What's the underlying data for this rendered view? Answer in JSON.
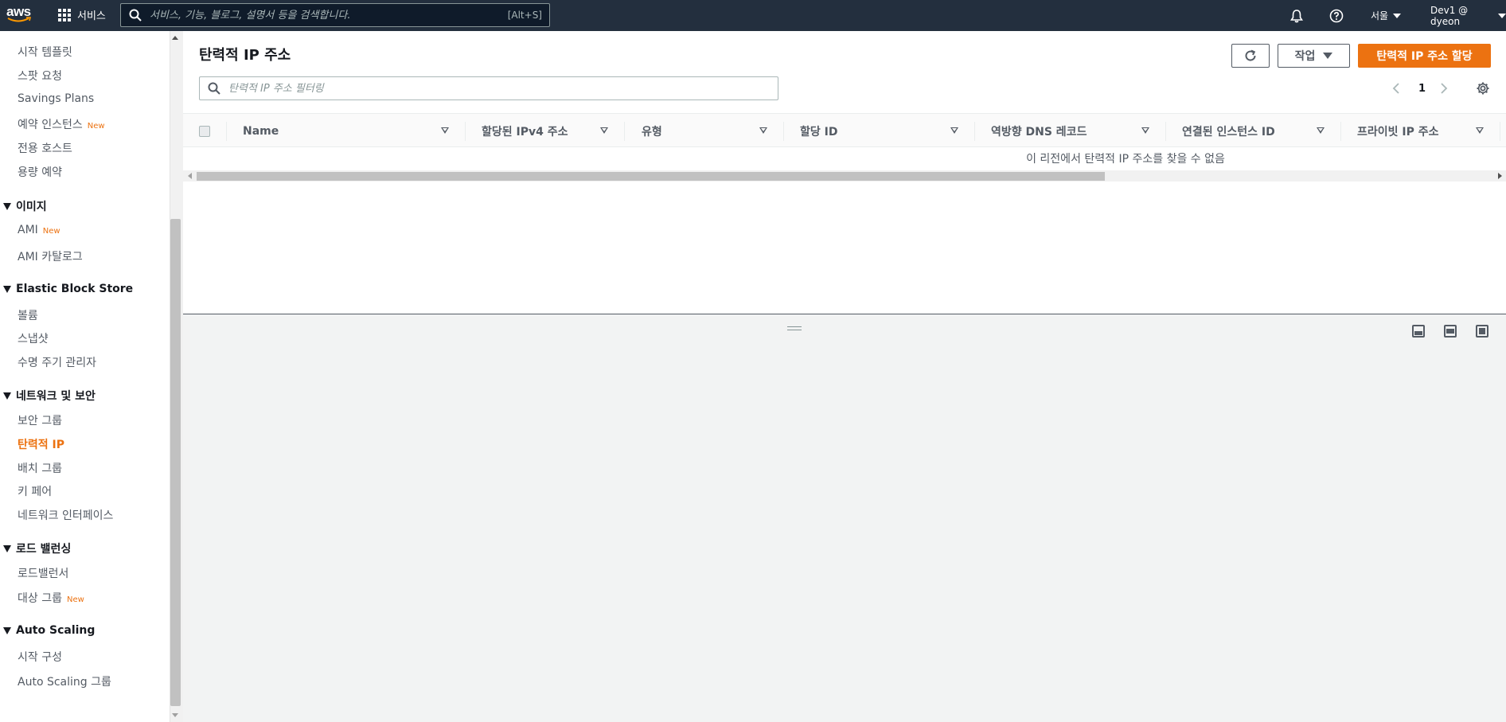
{
  "topnav": {
    "logo_text": "aws",
    "services_label": "서비스",
    "search_placeholder": "서비스, 기능, 블로그, 설명서 등을 검색합니다.",
    "search_shortcut": "[Alt+S]",
    "region_label": "서울",
    "account_label": "Dev1 @ dyeon",
    "icons": [
      "grid-icon",
      "search-icon",
      "bell-icon",
      "help-icon"
    ]
  },
  "sidebar": {
    "items": [
      {
        "label": "시작 템플릿"
      },
      {
        "label": "스팟 요청"
      },
      {
        "label": "Savings Plans"
      },
      {
        "label": "예약 인스턴스",
        "badge": "New"
      },
      {
        "label": "전용 호스트"
      },
      {
        "label": "용량 예약"
      }
    ],
    "sections": [
      {
        "title": "이미지",
        "items": [
          {
            "label": "AMI",
            "badge": "New"
          },
          {
            "label": "AMI 카탈로그"
          }
        ]
      },
      {
        "title": "Elastic Block Store",
        "items": [
          {
            "label": "볼륨"
          },
          {
            "label": "스냅샷"
          },
          {
            "label": "수명 주기 관리자"
          }
        ]
      },
      {
        "title": "네트워크 및 보안",
        "items": [
          {
            "label": "보안 그룹"
          },
          {
            "label": "탄력적 IP",
            "active": true
          },
          {
            "label": "배치 그룹"
          },
          {
            "label": "키 페어"
          },
          {
            "label": "네트워크 인터페이스"
          }
        ]
      },
      {
        "title": "로드 밸런싱",
        "items": [
          {
            "label": "로드밸런서"
          },
          {
            "label": "대상 그룹",
            "badge": "New"
          }
        ]
      },
      {
        "title": "Auto Scaling",
        "items": [
          {
            "label": "시작 구성"
          },
          {
            "label": "Auto Scaling 그룹"
          }
        ]
      }
    ]
  },
  "main": {
    "title": "탄력적 IP 주소",
    "actions_label": "작업",
    "primary_button": "탄력적 IP 주소 할당",
    "filter_placeholder": "탄력적 IP 주소 필터링",
    "page_number": "1",
    "columns": [
      "Name",
      "할당된 IPv4 주소",
      "유형",
      "할당 ID",
      "역방향 DNS 레코드",
      "연결된 인스턴스 ID",
      "프라이빗 IP 주소"
    ],
    "empty_message": "이 리전에서 탄력적 IP 주소를 찾을 수 없음"
  },
  "colors": {
    "nav_bg": "#232f3e",
    "accent": "#ec7211",
    "text_muted": "#545b64"
  }
}
